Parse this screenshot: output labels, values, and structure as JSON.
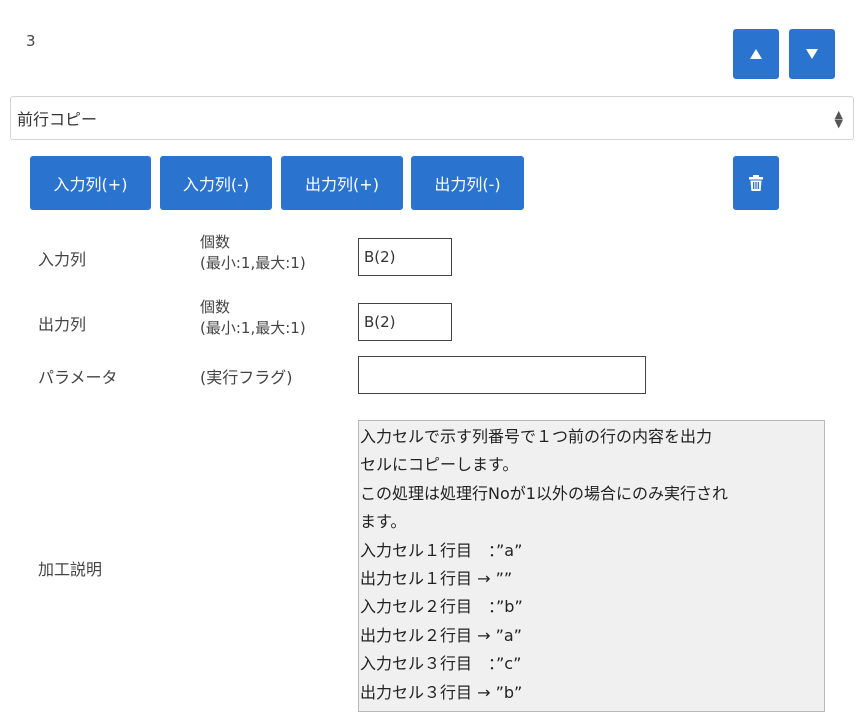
{
  "step": {
    "number": "3"
  },
  "controls": {
    "up_icon": "triangle-up-icon",
    "down_icon": "triangle-down-icon"
  },
  "process_select": {
    "value": "前行コピー"
  },
  "buttons": {
    "input_col_add": "入力列(+)",
    "input_col_remove": "入力列(-)",
    "output_col_add": "出力列(+)",
    "output_col_remove": "出力列(-)",
    "delete_icon": "trash-icon"
  },
  "fields": {
    "input_col": {
      "label": "入力列",
      "sub_label_1": "個数",
      "sub_label_2": "(最小:1,最大:1)",
      "value": "B(2)"
    },
    "output_col": {
      "label": "出力列",
      "sub_label_1": "個数",
      "sub_label_2": "(最小:1,最大:1)",
      "value": "B(2)"
    },
    "parameter": {
      "label": "パラメータ",
      "sub_label": "(実行フラグ)",
      "value": ""
    },
    "description": {
      "label": "加工説明",
      "lines": [
        "入力セルで示す列番号で１つ前の行の内容を出力",
        "セルにコピーします。",
        "この処理は処理行Noが1以外の場合にのみ実行され",
        "ます。",
        "入力セル１行目　：”a”",
        "出力セル１行目 → ””",
        "入力セル２行目　：”b”",
        "出力セル２行目 → ”a”",
        "入力セル３行目　：”c”",
        "出力セル３行目 → ”b”"
      ]
    }
  },
  "colors": {
    "primary": "#2a73cf"
  }
}
